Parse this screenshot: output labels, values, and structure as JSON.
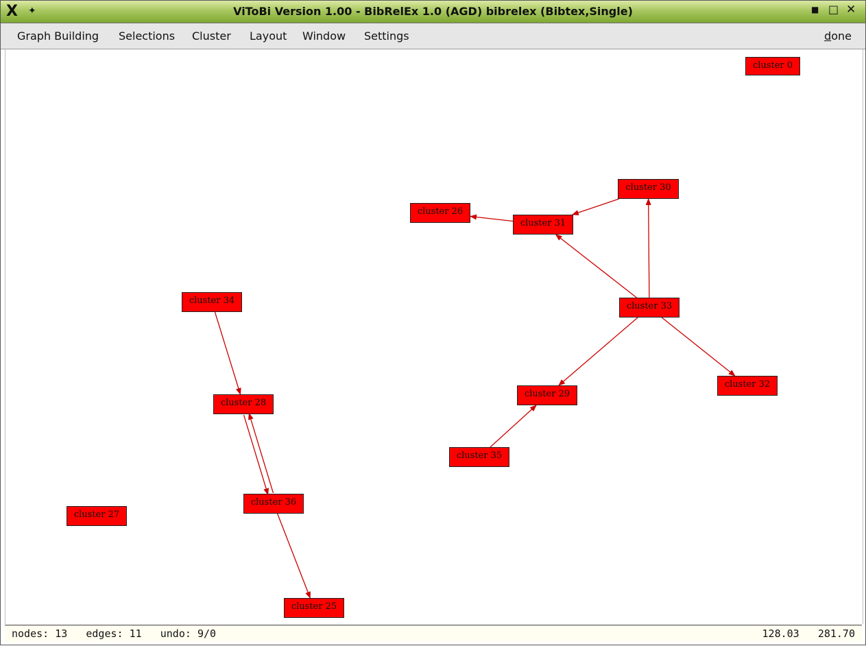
{
  "window": {
    "title": "ViToBi  Version 1.00 - BibRelEx 1.0 (AGD) bibrelex (Bibtex,Single)",
    "icons": [
      "x-logo-icon",
      "pin-icon",
      "minimize-icon",
      "maximize-icon",
      "close-icon"
    ]
  },
  "menu": {
    "items": [
      "Graph Building",
      "Selections",
      "Cluster",
      "Layout",
      "Window",
      "Settings"
    ],
    "done_first": "d",
    "done_rest": "one"
  },
  "graph": {
    "nodes": [
      {
        "id": "c0",
        "label": "cluster 0"
      },
      {
        "id": "c30",
        "label": "cluster 30"
      },
      {
        "id": "c26",
        "label": "cluster 26"
      },
      {
        "id": "c31",
        "label": "cluster 31"
      },
      {
        "id": "c34",
        "label": "cluster 34"
      },
      {
        "id": "c33",
        "label": "cluster 33"
      },
      {
        "id": "c29",
        "label": "cluster 29"
      },
      {
        "id": "c32",
        "label": "cluster 32"
      },
      {
        "id": "c28",
        "label": "cluster 28"
      },
      {
        "id": "c35",
        "label": "cluster 35"
      },
      {
        "id": "c27",
        "label": "cluster 27"
      },
      {
        "id": "c36",
        "label": "cluster 36"
      },
      {
        "id": "c25",
        "label": "cluster 25"
      }
    ],
    "edges": [
      {
        "from": "c33",
        "to": "c30"
      },
      {
        "from": "c33",
        "to": "c31"
      },
      {
        "from": "c30",
        "to": "c31"
      },
      {
        "from": "c31",
        "to": "c26"
      },
      {
        "from": "c33",
        "to": "c29"
      },
      {
        "from": "c33",
        "to": "c32"
      },
      {
        "from": "c35",
        "to": "c29"
      },
      {
        "from": "c34",
        "to": "c28"
      },
      {
        "from": "c28",
        "to": "c36"
      },
      {
        "from": "c36",
        "to": "c28"
      },
      {
        "from": "c36",
        "to": "c25"
      }
    ],
    "edge_color": "#cc0000",
    "node_color": "#ff0000"
  },
  "status": {
    "nodes": "13",
    "edges": "11",
    "undo": "9/0",
    "coord_x": "128.03",
    "coord_y": "281.70"
  }
}
